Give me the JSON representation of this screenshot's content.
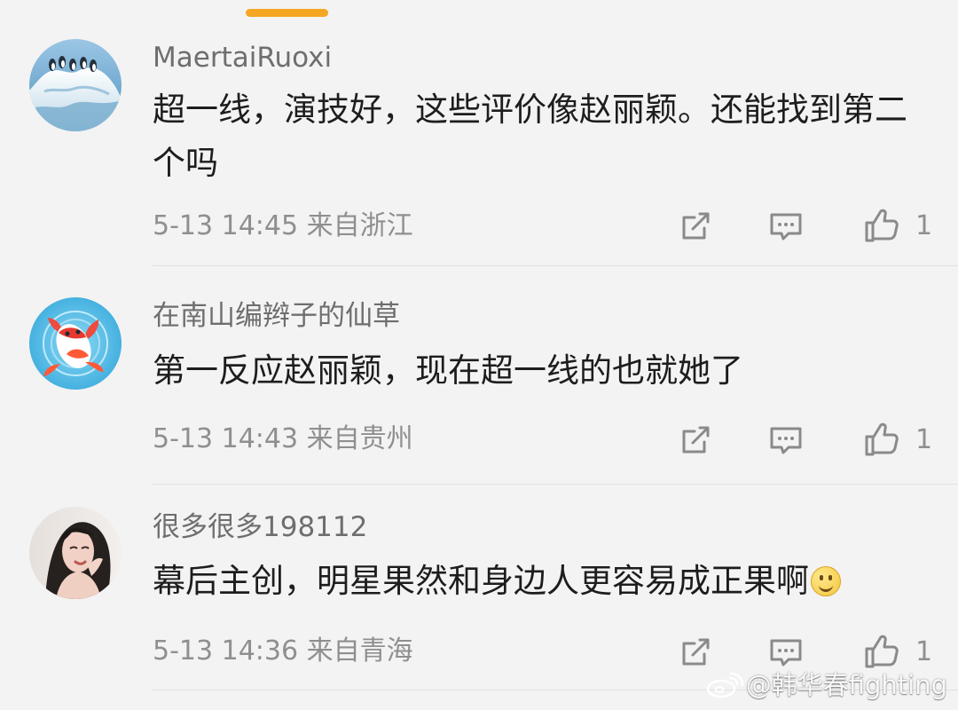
{
  "colors": {
    "background": "#f3f3f3",
    "accent": "#f5a623",
    "username": "#6e6e6e",
    "text": "#1d1d1d",
    "meta": "#8f8f8f"
  },
  "comments": [
    {
      "username": "MaertaiRuoxi",
      "text": "超一线，演技好，这些评价像赵丽颖。还能找到第二个吗",
      "time": "5-13 14:45",
      "location": "来自浙江",
      "likes": "1",
      "avatar_icon": "penguin-iceberg-avatar"
    },
    {
      "username": "在南山编辫子的仙草",
      "text": "第一反应赵丽颖，现在超一线的也就她了",
      "time": "5-13 14:43",
      "location": "来自贵州",
      "likes": "1",
      "avatar_icon": "koi-fish-avatar"
    },
    {
      "username": "很多很多198112",
      "text": "幕后主创，明星果然和身边人更容易成正果啊",
      "time": "5-13 14:36",
      "location": "来自青海",
      "likes": "1",
      "avatar_icon": "woman-portrait-avatar",
      "emoji": "smile-emoji"
    }
  ],
  "icons": {
    "share": "share-icon",
    "reply": "comment-icon",
    "like": "thumbs-up-icon"
  },
  "watermark": {
    "text": "@韩华春fighting",
    "icon": "weibo-logo"
  }
}
